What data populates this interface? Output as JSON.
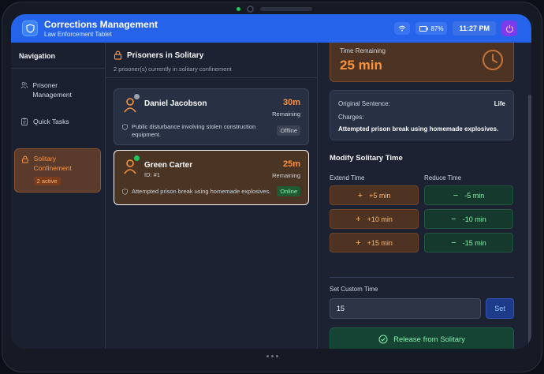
{
  "header": {
    "title": "Corrections Management",
    "subtitle": "Law Enforcement Tablet",
    "battery": "87%",
    "time": "11:27 PM"
  },
  "sidebar": {
    "title": "Navigation",
    "items": [
      {
        "label": "Prisoner Management",
        "icon": "users-icon"
      },
      {
        "label": "Quick Tasks",
        "icon": "clipboard-icon"
      },
      {
        "label": "Solitary Confinement",
        "icon": "lock-icon",
        "badge": "2 active",
        "active": true
      }
    ]
  },
  "solitary": {
    "title": "Prisoners in Solitary",
    "subtitle": "2 prisoner(s) currently in solitary confinement",
    "prisoners": [
      {
        "name": "Daniel Jacobson",
        "id": "",
        "time": "30m",
        "remaining": "Remaining",
        "charge": "Public disturbance involving stolen construction equipment.",
        "status": "Offline"
      },
      {
        "name": "Green Carter",
        "id": "ID: #1",
        "time": "25m",
        "remaining": "Remaining",
        "charge": "Attempted prison break using homemade explosives.",
        "status": "Online",
        "selected": true
      }
    ]
  },
  "detail": {
    "time_label": "Time Remaining",
    "time_value": "25 min",
    "sentence_label": "Original Sentence:",
    "sentence_value": "Life",
    "charges_label": "Charges:",
    "charges_value": "Attempted prison break using homemade explosives.",
    "modify_title": "Modify Solitary Time",
    "extend_label": "Extend Time",
    "reduce_label": "Reduce Time",
    "extend": [
      "+5 min",
      "+10 min",
      "+15 min"
    ],
    "reduce": [
      "-5 min",
      "-10 min",
      "-15 min"
    ],
    "custom_label": "Set Custom Time",
    "custom_value": "15",
    "set_label": "Set",
    "release_label": "Release from Solitary"
  },
  "colors": {
    "accent": "#2563eb",
    "orange": "#fb923c",
    "green": "#86efac"
  }
}
